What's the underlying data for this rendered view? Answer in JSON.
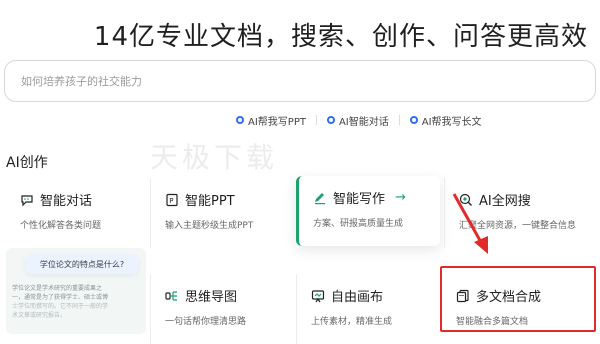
{
  "hero": {
    "title": "14亿专业文档，搜索、创作、问答更高效"
  },
  "search": {
    "placeholder": "如何培养孩子的社交能力"
  },
  "quick_links": [
    {
      "label": "AI帮我写PPT",
      "icon": "ai-sparkle-icon"
    },
    {
      "label": "AI智能对话",
      "icon": "ai-sparkle-icon"
    },
    {
      "label": "AI帮我写长文",
      "icon": "ai-sparkle-icon"
    }
  ],
  "section": {
    "title": "AI创作"
  },
  "watermark": {
    "text": "天极下载"
  },
  "cards": {
    "chat": {
      "title": "智能对话",
      "desc": "个性化解答各类问题",
      "icon": "chat-icon"
    },
    "ppt": {
      "title": "智能PPT",
      "desc": "输入主题秒级生成PPT",
      "icon": "ppt-icon"
    },
    "write": {
      "title": "智能写作",
      "arrow": "→",
      "desc": "方案、研报高质量生成",
      "icon": "pen-icon"
    },
    "websearch": {
      "title": "AI全网搜",
      "desc": "汇聚全网资源，一键整合信息",
      "icon": "web-search-icon"
    },
    "mindmap": {
      "title": "思维导图",
      "desc": "一句话帮你理清思路",
      "icon": "mindmap-icon"
    },
    "canvas": {
      "title": "自由画布",
      "desc": "上传素材，精准生成",
      "icon": "canvas-icon"
    },
    "multidoc": {
      "title": "多文档合成",
      "desc": "智能融合多篇文档",
      "icon": "multi-doc-icon"
    }
  },
  "preview": {
    "question": "学位论文的特点是什么?",
    "lines": [
      "学位论文是学术研究的重要成果之",
      "一，通常是为了获得学士、硕士或博",
      "士学位而撰写的。它不同于一般的学",
      "术文章或研究报告。"
    ]
  },
  "colors": {
    "accent": "#1ba36b",
    "link_icon": "#2f6df2",
    "highlight": "#e12b2b"
  }
}
